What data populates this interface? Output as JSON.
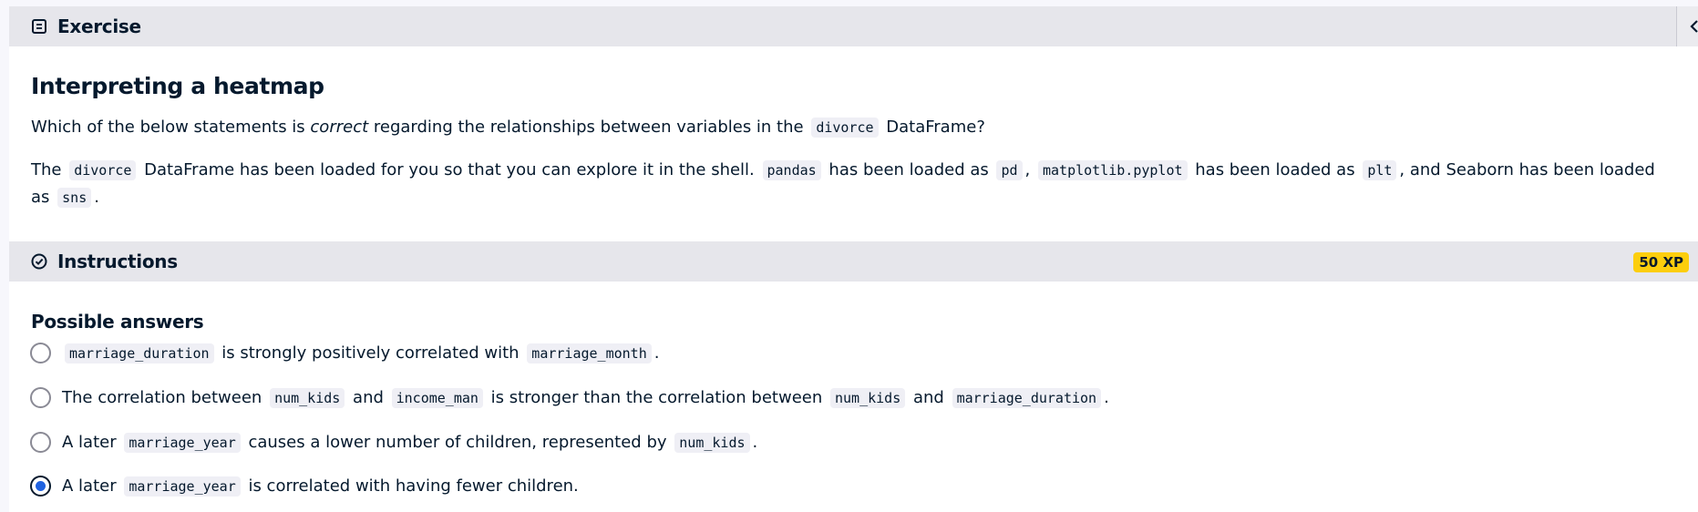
{
  "exercise_bar": {
    "label": "Exercise"
  },
  "exercise": {
    "title": "Interpreting a heatmap",
    "question": {
      "before": "Which of the below statements is ",
      "emphasis": "correct",
      "middle": " regarding the relationships between variables in the ",
      "code": "divorce",
      "after": " DataFrame?"
    },
    "context": {
      "t1": "The ",
      "c1": "divorce",
      "t2": " DataFrame has been loaded for you so that you can explore it in the shell. ",
      "c2": "pandas",
      "t3": " has been loaded as ",
      "c3": "pd",
      "t4": ", ",
      "c4": "matplotlib.pyplot",
      "t5": " has been loaded as ",
      "c5": "plt",
      "t6": ", and Seaborn has been loaded as ",
      "c6": "sns",
      "t7": "."
    }
  },
  "instructions_bar": {
    "label": "Instructions",
    "xp": "50 XP"
  },
  "answers": {
    "heading": "Possible answers",
    "selected_index": 3,
    "a1": {
      "c1": "marriage_duration",
      "t1": " is strongly positively correlated with ",
      "c2": "marriage_month",
      "t2": "."
    },
    "a2": {
      "t0": "The correlation between ",
      "c1": "num_kids",
      "t1": " and ",
      "c2": "income_man",
      "t2": " is stronger than the correlation between ",
      "c3": "num_kids",
      "t3": " and ",
      "c4": "marriage_duration",
      "t4": "."
    },
    "a3": {
      "t0": "A later ",
      "c1": "marriage_year",
      "t1": " causes a lower number of children, represented by ",
      "c2": "num_kids",
      "t2": "."
    },
    "a4": {
      "t0": "A later ",
      "c1": "marriage_year",
      "t1": " is correlated with having fewer children."
    }
  },
  "colors": {
    "accent": "#1f62e0",
    "xp_badge": "#fcce0d",
    "bar_bg": "#e6e6eb",
    "text": "#05192d"
  }
}
